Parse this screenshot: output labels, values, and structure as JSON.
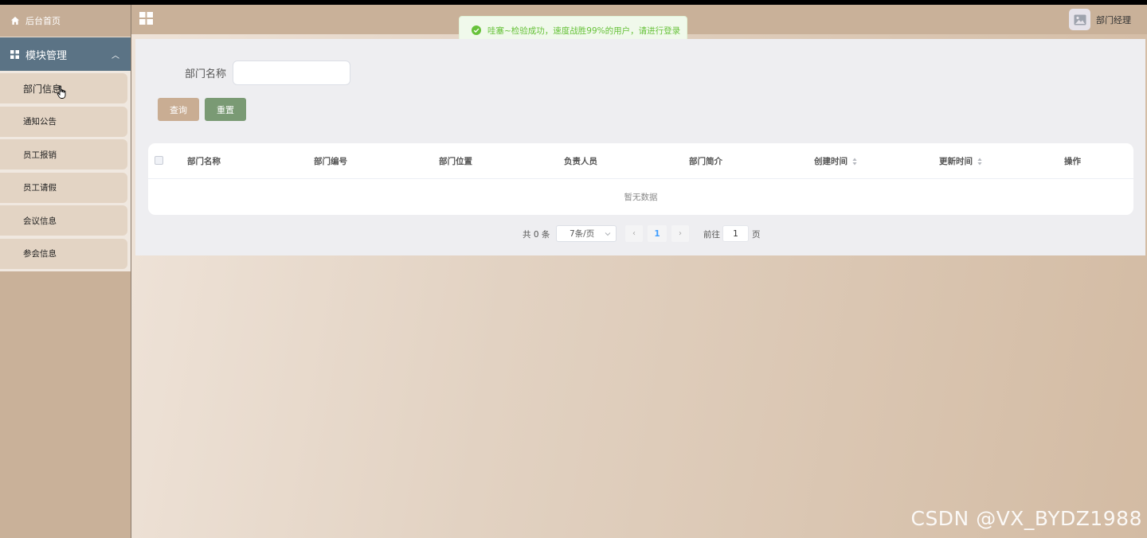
{
  "sidebar": {
    "home_label": "后台首页",
    "module_label": "模块管理",
    "items": [
      {
        "label": "部门信息"
      },
      {
        "label": "通知公告"
      },
      {
        "label": "员工报销"
      },
      {
        "label": "员工请假"
      },
      {
        "label": "会议信息"
      },
      {
        "label": "参会信息"
      }
    ]
  },
  "header": {
    "user_name": "部门经理"
  },
  "toast": {
    "message": "哇塞~检验成功，速度战胜99%的用户，请进行登录"
  },
  "search": {
    "label": "部门名称",
    "value": "",
    "placeholder": "",
    "query_label": "查询",
    "reset_label": "重置"
  },
  "table": {
    "columns": [
      "部门名称",
      "部门编号",
      "部门位置",
      "负责人员",
      "部门简介",
      "创建时间",
      "更新时间",
      "操作"
    ],
    "empty_text": "暂无数据"
  },
  "pagination": {
    "total_text": "共 0 条",
    "page_size": "7条/页",
    "current_page": "1",
    "goto_label": "前往",
    "goto_value": "1",
    "page_unit": "页"
  },
  "watermark": "CSDN @VX_BYDZ1988",
  "colors": {
    "sidebar_bg": "#c9b199",
    "module_header": "#5b7385",
    "query_button": "#c9ad93",
    "reset_button": "#7a9a74",
    "toast_text": "#67c23a"
  }
}
